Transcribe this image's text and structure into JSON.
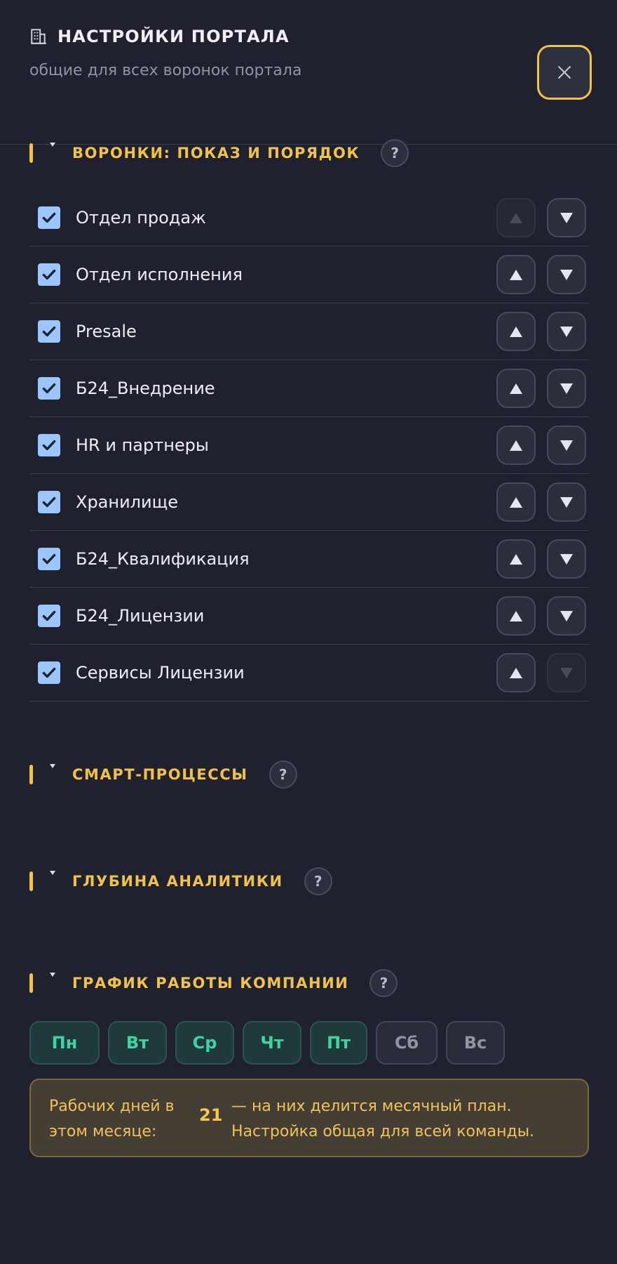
{
  "header": {
    "title": "НАСТРОЙКИ ПОРТАЛА",
    "subtitle": "общие для всех воронок портала",
    "title_icon": "building-icon",
    "close_icon": "close-icon"
  },
  "sections": {
    "funnels": {
      "title": "ВОРОНКИ: ПОКАЗ И ПОРЯДОК",
      "help": "?",
      "items": [
        {
          "name": "Отдел продаж",
          "checked": true,
          "up_disabled": true,
          "down_disabled": false
        },
        {
          "name": "Отдел исполнения",
          "checked": true,
          "up_disabled": false,
          "down_disabled": false
        },
        {
          "name": "Presale",
          "checked": true,
          "up_disabled": false,
          "down_disabled": false
        },
        {
          "name": "Б24_Внедрение",
          "checked": true,
          "up_disabled": false,
          "down_disabled": false
        },
        {
          "name": "HR и партнеры",
          "checked": true,
          "up_disabled": false,
          "down_disabled": false
        },
        {
          "name": "Хранилище",
          "checked": true,
          "up_disabled": false,
          "down_disabled": false
        },
        {
          "name": "Б24_Квалификация",
          "checked": true,
          "up_disabled": false,
          "down_disabled": false
        },
        {
          "name": "Б24_Лицензии",
          "checked": true,
          "up_disabled": false,
          "down_disabled": false
        },
        {
          "name": "Сервисы Лицензии",
          "checked": true,
          "up_disabled": false,
          "down_disabled": true
        }
      ]
    },
    "smart": {
      "title": "СМАРТ-ПРОЦЕССЫ",
      "help": "?"
    },
    "depth": {
      "title": "ГЛУБИНА АНАЛИТИКИ",
      "help": "?"
    },
    "schedule": {
      "title": "ГРАФИК РАБОТЫ КОМПАНИИ",
      "help": "?",
      "days": [
        {
          "label": "Пн",
          "active": true
        },
        {
          "label": "Вт",
          "active": true
        },
        {
          "label": "Ср",
          "active": true
        },
        {
          "label": "Чт",
          "active": true
        },
        {
          "label": "Пт",
          "active": true
        },
        {
          "label": "Сб",
          "active": false
        },
        {
          "label": "Вс",
          "active": false
        }
      ],
      "info": {
        "label": "Рабочих дней в этом месяце:",
        "count": "21",
        "desc": "— на них делится месячный план. Настройка общая для всей команды."
      }
    }
  },
  "colors": {
    "accent": "#f2c14a",
    "background": "#1f222e",
    "checkbox": "#9cc6fb",
    "day_active": "#3fd3a2"
  }
}
